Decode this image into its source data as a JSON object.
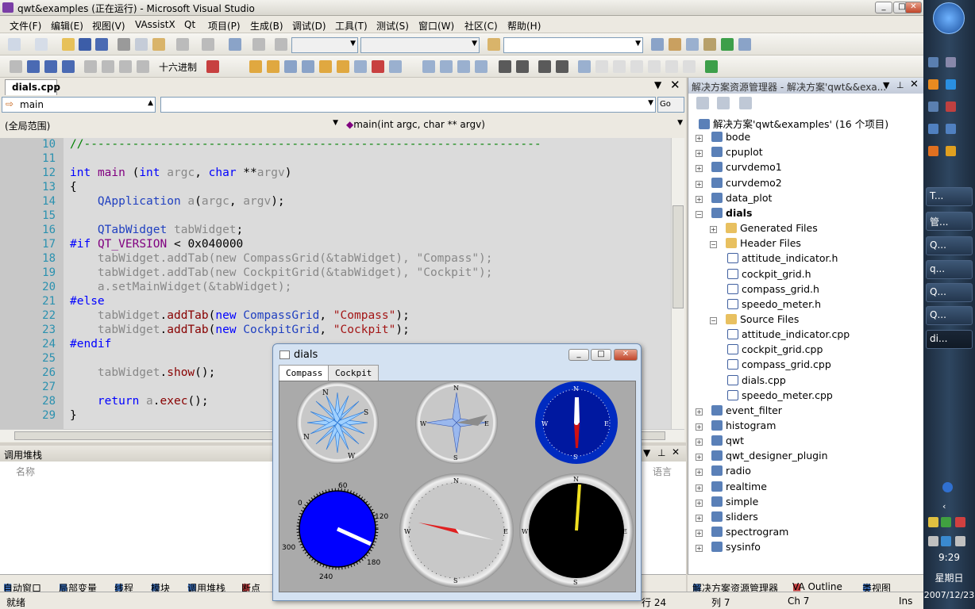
{
  "window": {
    "title": "qwt&examples (正在运行) - Microsoft Visual Studio"
  },
  "menu": [
    "文件(F)",
    "编辑(E)",
    "视图(V)",
    "VAssistX",
    "Qt",
    "项目(P)",
    "生成(B)",
    "调试(D)",
    "工具(T)",
    "测试(S)",
    "窗口(W)",
    "社区(C)",
    "帮助(H)"
  ],
  "toolbar": {
    "hex_label": "十六进制"
  },
  "editor": {
    "tab": "dials.cpp",
    "scope_value": "main",
    "scope_global": "(全局范围)",
    "function_value": "main(int argc, char ** argv)",
    "go_label": "Go"
  },
  "code": {
    "line_numbers": [
      "10",
      "11",
      "12",
      "13",
      "14",
      "15",
      "16",
      "17",
      "18",
      "19",
      "20",
      "21",
      "22",
      "23",
      "24",
      "25",
      "26",
      "27",
      "28",
      "29"
    ]
  },
  "callstack": {
    "title": "调用堆栈",
    "col_name": "名称",
    "col_lang": "语言"
  },
  "bottom_tabs": [
    "自动窗口",
    "局部变量",
    "线程",
    "模块",
    "调用堆栈",
    "断点"
  ],
  "status": {
    "ready": "就绪",
    "row": "行 24",
    "col": "列 7",
    "ch": "Ch 7",
    "ins": "Ins"
  },
  "solution": {
    "title": "解决方案资源管理器 - 解决方案'qwt&&exa...",
    "root": "解决方案'qwt&examples' (16 个项目)",
    "projects_top": [
      "bode",
      "cpuplot",
      "curvdemo1",
      "curvdemo2",
      "data_plot"
    ],
    "active_project": "dials",
    "generated": "Generated Files",
    "header_folder": "Header Files",
    "headers": [
      "attitude_indicator.h",
      "cockpit_grid.h",
      "compass_grid.h",
      "speedo_meter.h"
    ],
    "source_folder": "Source Files",
    "sources": [
      "attitude_indicator.cpp",
      "cockpit_grid.cpp",
      "compass_grid.cpp",
      "dials.cpp",
      "speedo_meter.cpp"
    ],
    "projects_bottom": [
      "event_filter",
      "histogram",
      "qwt",
      "qwt_designer_plugin",
      "radio",
      "realtime",
      "simple",
      "sliders",
      "spectrogram",
      "sysinfo"
    ],
    "tabs": [
      "解决方案资源管理器",
      "VA Outline",
      "类视图"
    ]
  },
  "dials_window": {
    "title": "dials",
    "tabs": [
      "Compass",
      "Cockpit"
    ],
    "compass_letters": [
      "N",
      "E",
      "S",
      "W"
    ],
    "speedo_ticks": [
      "0",
      "60",
      "120",
      "180",
      "240",
      "300"
    ]
  },
  "taskbar": {
    "buttons": [
      "T...",
      "管...",
      "Q...",
      "q...",
      "Q...",
      "Q...",
      "di..."
    ],
    "time": "9:29",
    "day": "星期日",
    "date": "2007/12/23"
  }
}
